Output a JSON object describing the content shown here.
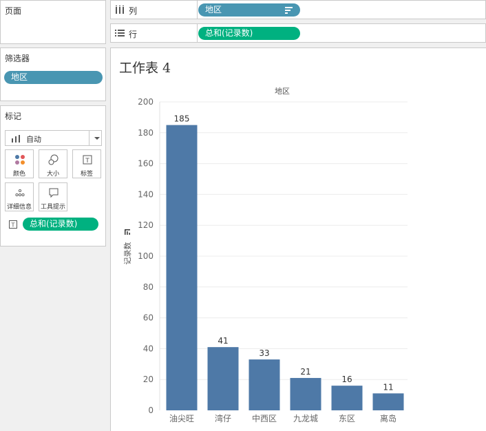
{
  "pages_panel": {
    "title": "页面"
  },
  "filters_panel": {
    "title": "筛选器",
    "pill": "地区"
  },
  "marks_panel": {
    "title": "标记",
    "mark_type": "自动",
    "buttons": [
      {
        "label": "颜色",
        "icon": "color-icon"
      },
      {
        "label": "大小",
        "icon": "size-icon"
      },
      {
        "label": "标签",
        "icon": "label-icon"
      },
      {
        "label": "详细信息",
        "icon": "detail-icon"
      },
      {
        "label": "工具提示",
        "icon": "tooltip-icon"
      }
    ],
    "pill": "总和(记录数)"
  },
  "shelves": {
    "columns": {
      "label": "列",
      "pill": "地区"
    },
    "rows": {
      "label": "行",
      "pill": "总和(记录数)"
    }
  },
  "sheet": {
    "title": "工作表 4"
  },
  "colors": {
    "bar": "#4e79a7",
    "blue_pill": "#4996b2",
    "green_pill": "#00b180"
  },
  "chart_data": {
    "type": "bar",
    "title": "地区",
    "xlabel": "",
    "ylabel": "记录数",
    "categories": [
      "油尖旺",
      "湾仔",
      "中西区",
      "九龙城",
      "东区",
      "离岛"
    ],
    "values": [
      185,
      41,
      33,
      21,
      16,
      11
    ],
    "ylim": [
      0,
      200
    ],
    "yticks": [
      0,
      20,
      40,
      60,
      80,
      100,
      120,
      140,
      160,
      180,
      200
    ],
    "grid": true,
    "data_labels": true
  }
}
